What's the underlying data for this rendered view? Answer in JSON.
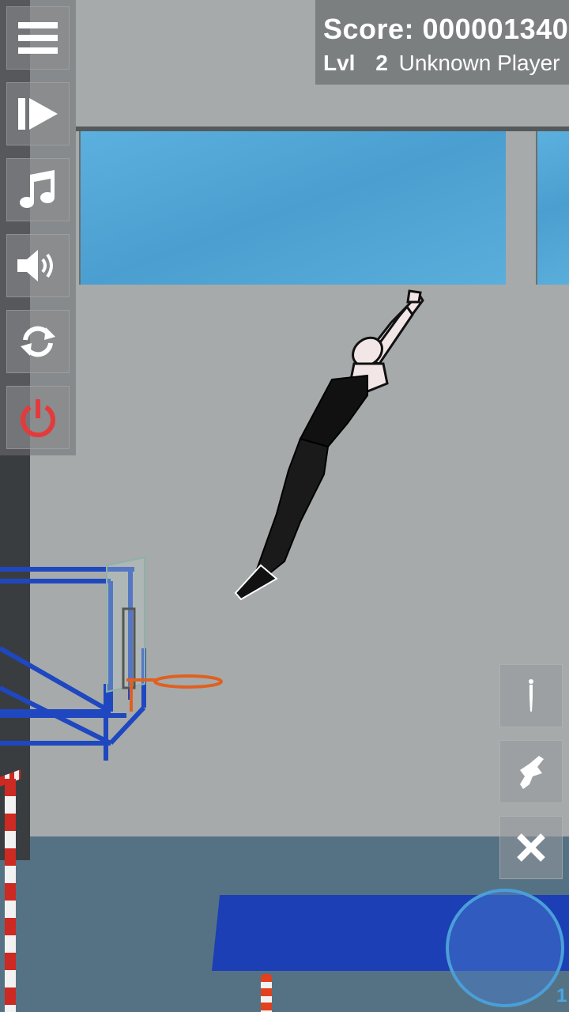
{
  "hud": {
    "score_label": "Score: 000001340",
    "level_label": "Lvl",
    "level_value": "2",
    "player_name": "Unknown Player"
  },
  "side_menu": {
    "items": [
      {
        "icon": "menu-icon"
      },
      {
        "icon": "next-icon"
      },
      {
        "icon": "music-icon"
      },
      {
        "icon": "volume-icon"
      },
      {
        "icon": "restart-icon"
      },
      {
        "icon": "power-icon",
        "color": "#e33b3b"
      }
    ]
  },
  "right_controls": {
    "items": [
      {
        "icon": "stand-pose-icon"
      },
      {
        "icon": "tuck-pose-icon"
      },
      {
        "icon": "close-icon"
      }
    ]
  },
  "joystick": {
    "count": "1"
  },
  "colors": {
    "sky_window": "#4aa3d6",
    "mat": "#1c3fb5",
    "floor": "#557285",
    "power_accent": "#e33b3b",
    "joystick_ring": "#4a9fd8"
  }
}
